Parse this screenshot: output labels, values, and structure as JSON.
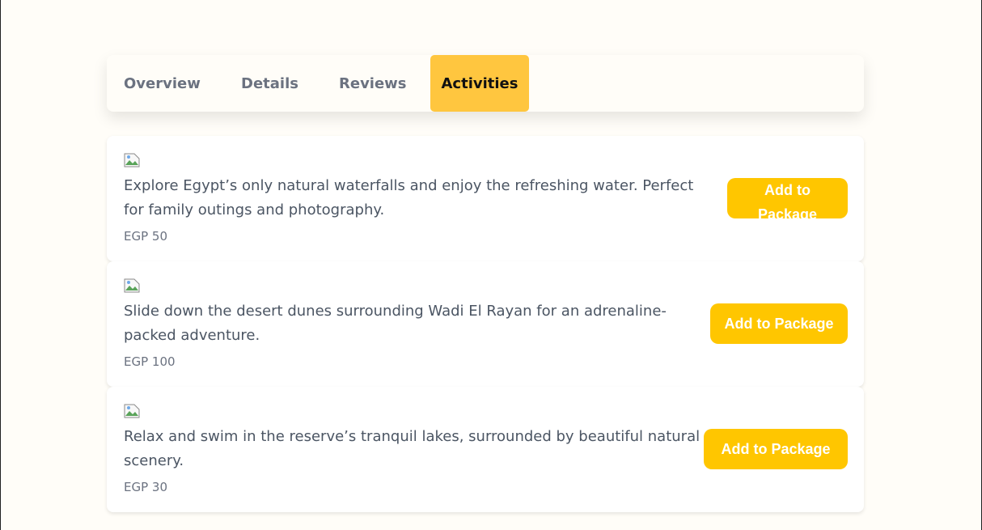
{
  "tabs": [
    {
      "label": "Overview"
    },
    {
      "label": "Details"
    },
    {
      "label": "Reviews"
    },
    {
      "label": "Activities",
      "active": true
    }
  ],
  "activities": [
    {
      "image_icon": "broken-image-icon",
      "description": "Explore Egypt’s only natural waterfalls and enjoy the refreshing water. Perfect for family outings and photography.",
      "price": "EGP 50",
      "button_label": "Add to Package"
    },
    {
      "image_icon": "broken-image-icon",
      "description": "Slide down the desert dunes surrounding Wadi El Rayan for an adrenaline-packed adventure.",
      "price": "EGP 100",
      "button_label": "Add to Package"
    },
    {
      "image_icon": "broken-image-icon",
      "description": "Relax and swim in the reserve’s tranquil lakes, surrounded by beautiful natural scenery.",
      "price": "EGP 30",
      "button_label": "Add to Package"
    }
  ],
  "colors": {
    "accent": "#ffc600",
    "active_tab": "#ffc63f",
    "background": "#fffdf8"
  }
}
